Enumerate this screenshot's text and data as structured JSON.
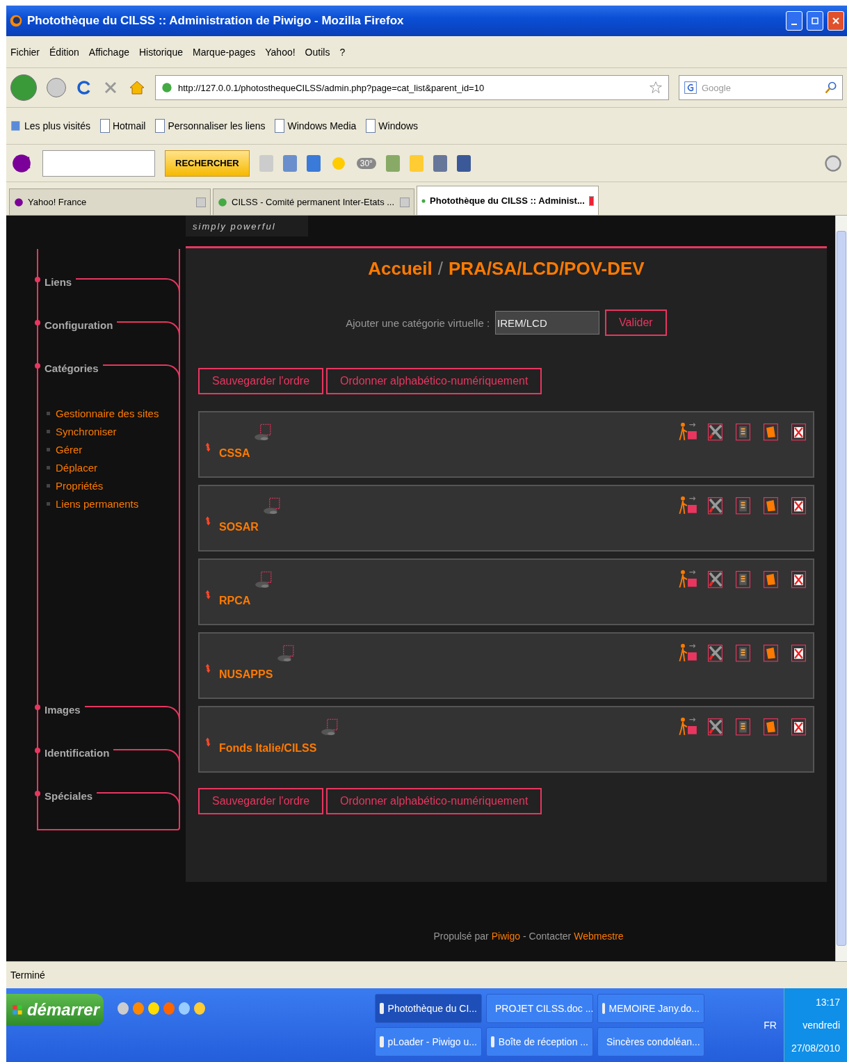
{
  "window": {
    "title": "Photothèque du CILSS :: Administration de Piwigo - Mozilla Firefox"
  },
  "menu": [
    "Fichier",
    "Édition",
    "Affichage",
    "Historique",
    "Marque-pages",
    "Yahoo!",
    "Outils",
    "?"
  ],
  "address": {
    "value": "http://127.0.0.1/photosthequeCILSS/admin.php?page=cat_list&parent_id=10"
  },
  "search": {
    "placeholder": "Google"
  },
  "bookmarks": [
    "Les plus visités",
    "Hotmail",
    "Personnaliser les liens",
    "Windows Media",
    "Windows"
  ],
  "yahoo_toolbar": {
    "search_button": "RECHERCHER",
    "weather": "30°"
  },
  "tabs": [
    {
      "label": "Yahoo! France",
      "selected": false
    },
    {
      "label": "CILSS - Comité permanent Inter-Etats ...",
      "selected": false
    },
    {
      "label": "Photothèque du CILSS :: Administ...",
      "selected": true
    }
  ],
  "logo_tagline": "simply powerful",
  "sidebar": {
    "sections": [
      {
        "label": "Liens"
      },
      {
        "label": "Configuration"
      },
      {
        "label": "Catégories",
        "items": [
          "Gestionnaire des sites",
          "Synchroniser",
          "Gérer",
          "Déplacer",
          "Propriétés",
          "Liens permanents"
        ]
      },
      {
        "label": "Images"
      },
      {
        "label": "Identification"
      },
      {
        "label": "Spéciales"
      }
    ]
  },
  "main": {
    "breadcrumb": [
      "Accueil",
      "PRA/SA/LCD/POV-DEV"
    ],
    "separator": "/",
    "add_form": {
      "label": "Ajouter une catégorie virtuelle :",
      "value": "IREM/LCD",
      "button": "Valider"
    },
    "top_buttons": [
      "Sauvegarder l'ordre",
      "Ordonner alphabético-numériquement"
    ],
    "categories": [
      "CSSA",
      "SOSAR",
      "RPCA",
      "NUSAPPS",
      "Fonds Italie/CILSS"
    ],
    "bottom_buttons": [
      "Sauvegarder l'ordre",
      "Ordonner alphabético-numériquement"
    ]
  },
  "footer": {
    "prefix": "Propulsé par",
    "link": "Piwigo",
    "middle": "- Contacter",
    "contact_link": "Webmestre"
  },
  "status_bar": "Terminé",
  "taskbar": {
    "start": "démarrer",
    "tasks": [
      {
        "label": "Photothèque du CI...",
        "selected": true
      },
      {
        "label": "PROJET CILSS.doc ...",
        "selected": false
      },
      {
        "label": "MEMOIRE Jany.do...",
        "selected": false
      },
      {
        "label": "pLoader - Piwigo u...",
        "selected": false
      },
      {
        "label": "Boîte de réception ...",
        "selected": false
      },
      {
        "label": "Sincères condoléan...",
        "selected": false
      }
    ],
    "language": "FR",
    "time": "13:17",
    "day": "vendredi",
    "date": "27/08/2010"
  }
}
